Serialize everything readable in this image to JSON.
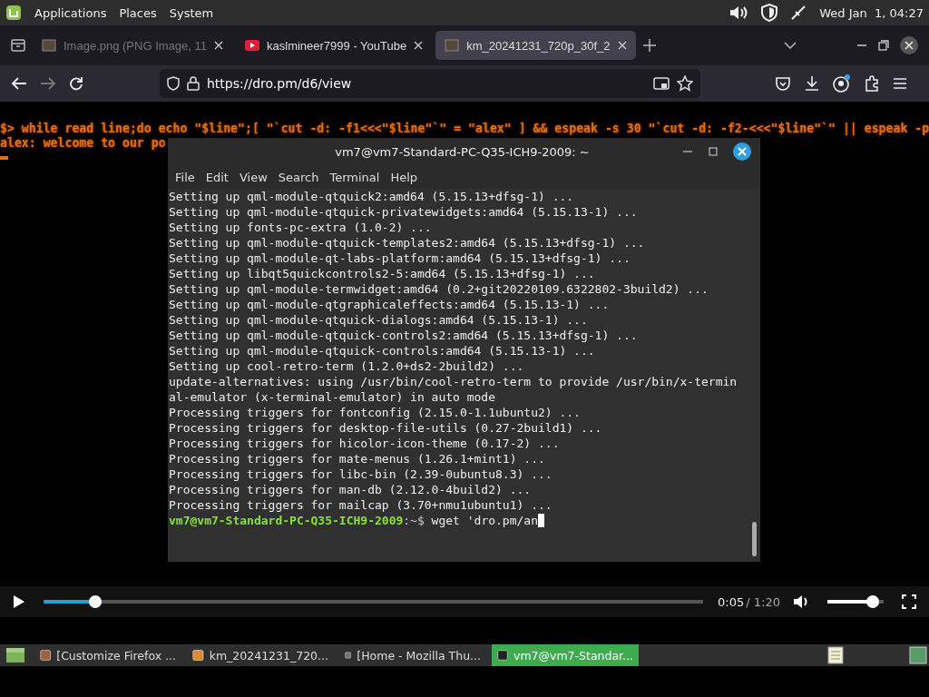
{
  "top_panel": {
    "menus": [
      "Applications",
      "Places",
      "System"
    ],
    "clock": "Wed Jan  1, 04:27"
  },
  "browser": {
    "tabs": [
      {
        "title": "Image.png (PNG Image, 11",
        "selected": false,
        "unloaded": true
      },
      {
        "title": "kaslmineer7999 - YouTube",
        "selected": false,
        "unloaded": false
      },
      {
        "title": "km_20241231_720p_30f_2",
        "selected": true,
        "unloaded": false
      }
    ],
    "url": "https://dro.pm/d6/view"
  },
  "video": {
    "background_lines": [
      "$> while read line;do echo \"$line\";[ \"`cut -d: -f1<<<\"$line\"`\" = \"alex\" ] && espeak -s 30 \"`cut -d: -f2-<<<\"$line\"`\" || espeak -p",
      "alex: welcome to our po"
    ],
    "terminal": {
      "title": "vm7@vm7-Standard-PC-Q35-ICH9-2009: ~",
      "menus": [
        "File",
        "Edit",
        "View",
        "Search",
        "Terminal",
        "Help"
      ],
      "lines": [
        "Setting up qml-module-qtquick2:amd64 (5.15.13+dfsg-1) ...",
        "Setting up qml-module-qtquick-privatewidgets:amd64 (5.15.13-1) ...",
        "Setting up fonts-pc-extra (1.0-2) ...",
        "Setting up qml-module-qtquick-templates2:amd64 (5.15.13+dfsg-1) ...",
        "Setting up qml-module-qt-labs-platform:amd64 (5.15.13+dfsg-1) ...",
        "Setting up libqt5quickcontrols2-5:amd64 (5.15.13+dfsg-1) ...",
        "Setting up qml-module-termwidget:amd64 (0.2+git20220109.6322802-3build2) ...",
        "Setting up qml-module-qtgraphicaleffects:amd64 (5.15.13-1) ...",
        "Setting up qml-module-qtquick-dialogs:amd64 (5.15.13-1) ...",
        "Setting up qml-module-qtquick-controls2:amd64 (5.15.13+dfsg-1) ...",
        "Setting up qml-module-qtquick-controls:amd64 (5.15.13-1) ...",
        "Setting up cool-retro-term (1.2.0+ds2-2build2) ...",
        "update-alternatives: using /usr/bin/cool-retro-term to provide /usr/bin/x-termin",
        "al-emulator (x-terminal-emulator) in auto mode",
        "Processing triggers for fontconfig (2.15.0-1.1ubuntu2) ...",
        "Processing triggers for desktop-file-utils (0.27-2build1) ...",
        "Processing triggers for hicolor-icon-theme (0.17-2) ...",
        "Processing triggers for mate-menus (1.26.1+mint1) ...",
        "Processing triggers for libc-bin (2.39-0ubuntu8.3) ...",
        "Processing triggers for man-db (2.12.0-4build2) ...",
        "Processing triggers for mailcap (3.70+nmu1ubuntu1) ..."
      ],
      "prompt_user": "vm7@vm7-Standard-PC-Q35-ICH9-2009",
      "prompt_path": ":~$",
      "command": "wget 'dro.pm/an"
    },
    "progress": {
      "level": 0.07
    },
    "time": "0:05",
    "duration": "/ 1:20",
    "volume": {
      "level": 0.9
    }
  },
  "taskbar": {
    "items": [
      {
        "label": "[Customize Firefox ...",
        "selected": false
      },
      {
        "label": "km_20241231_720...",
        "selected": false
      },
      {
        "label": "[Home - Mozilla Thu...",
        "selected": false
      },
      {
        "label": "vm7@vm7-Standar...",
        "selected": true
      }
    ]
  }
}
